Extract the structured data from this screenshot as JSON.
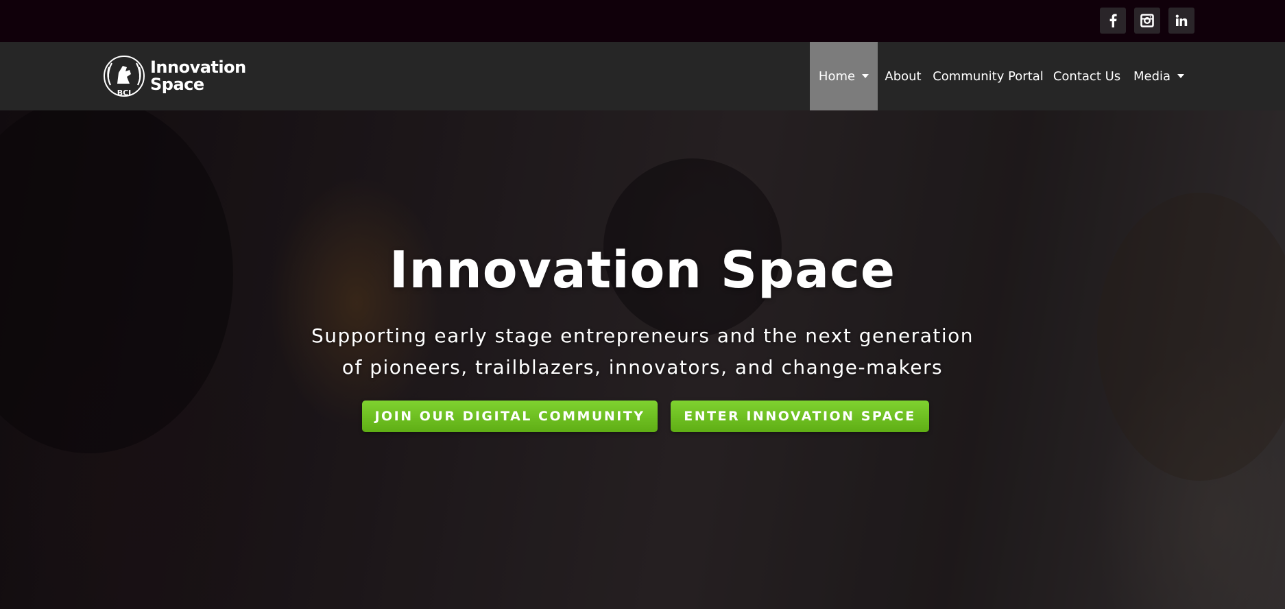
{
  "social": [
    {
      "icon": "facebook-icon",
      "glyph": "f"
    },
    {
      "icon": "instagram-icon",
      "glyph": ""
    },
    {
      "icon": "linkedin-icon",
      "glyph": "in"
    }
  ],
  "logo": {
    "line1": "Innovation",
    "line2": "Space",
    "emblem_text": "BCI"
  },
  "nav": {
    "items": [
      {
        "label": "Home",
        "active": true,
        "has_dropdown": true
      },
      {
        "label": "About",
        "active": false,
        "has_dropdown": false
      },
      {
        "label": "Community Portal",
        "active": false,
        "has_dropdown": false
      },
      {
        "label": "Contact Us",
        "active": false,
        "has_dropdown": false
      },
      {
        "label": "Media",
        "active": false,
        "has_dropdown": true
      }
    ]
  },
  "hero": {
    "title": "Innovation Space",
    "subtitle_line1": "Supporting early stage entrepreneurs and the next generation",
    "subtitle_line2": "of pioneers, trailblazers, innovators, and change-makers",
    "cta_primary": "JOIN OUR DIGITAL COMMUNITY",
    "cta_secondary": "ENTER INNOVATION SPACE"
  },
  "colors": {
    "topbar": "#10000a",
    "header": "#262626",
    "nav_active": "#7c7c7c",
    "cta_green": "#6cc11f"
  }
}
